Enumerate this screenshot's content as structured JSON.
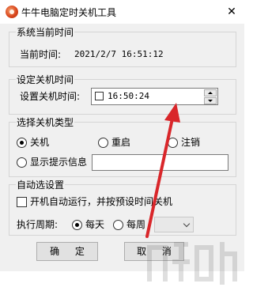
{
  "window": {
    "title": "牛牛电脑定时关机工具",
    "close_glyph": "✕"
  },
  "current_time": {
    "group_title": "系统当前时间",
    "label": "当前时间:",
    "value": "2021/2/7 16:51:12"
  },
  "set_shutdown": {
    "group_title": "设定关机时间",
    "label": "设置关机时间:",
    "time_value": "16:50:24"
  },
  "shutdown_type": {
    "group_title": "选择关机类型",
    "options": [
      {
        "label": "关机",
        "selected": true
      },
      {
        "label": "重启",
        "selected": false
      },
      {
        "label": "注销",
        "selected": false
      }
    ],
    "message_option": {
      "label": "显示提示信息",
      "selected": false,
      "value": ""
    }
  },
  "auto_settings": {
    "group_title": "自动选设置",
    "autorun": {
      "label": "开机自动运行，并按预设时间关机",
      "checked": false
    },
    "period": {
      "label": "执行周期:",
      "options": [
        {
          "label": "每天",
          "selected": true
        },
        {
          "label": "每周",
          "selected": false
        }
      ],
      "weekday_value": ""
    }
  },
  "buttons": {
    "ok": "确 定",
    "cancel": "取 消"
  },
  "annotation": {
    "arrow_color": "#d9262a"
  },
  "icons": {
    "app": "app-icon",
    "close": "close-icon",
    "spin_up": "chevron-up-icon",
    "spin_down": "chevron-down-icon",
    "dropdown": "chevron-down-icon"
  }
}
